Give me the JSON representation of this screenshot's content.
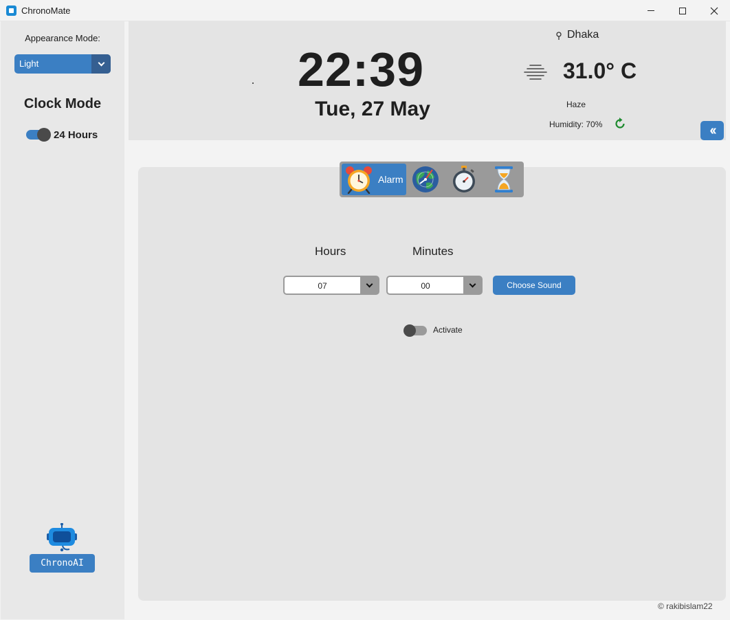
{
  "window": {
    "title": "ChronoMate",
    "controls": [
      "minimize-icon",
      "maximize-icon",
      "close-icon"
    ]
  },
  "sidebar": {
    "appearance_label": "Appearance Mode:",
    "appearance_value": "Light",
    "clock_mode_title": "Clock Mode",
    "hour_format_label": "24 Hours",
    "hour_format_on": true,
    "ai_button_label": "ChronoAI",
    "ai_icon": "robot-icon"
  },
  "header": {
    "time": "22:39",
    "date": "Tue, 27 May",
    "city": "Dhaka",
    "city_icon": "location-pin-icon",
    "temperature": "31.0° C",
    "weather_icon": "haze-icon",
    "condition": "Haze",
    "humidity": "Humidity: 70%",
    "refresh_icon": "refresh-icon",
    "collapse_label": "‹‹"
  },
  "tabs": {
    "alarm_label": "Alarm",
    "items": [
      {
        "name": "alarm",
        "icon": "alarm-clock-icon",
        "active": true
      },
      {
        "name": "world-clock",
        "icon": "world-clock-icon",
        "active": false
      },
      {
        "name": "stopwatch",
        "icon": "stopwatch-icon",
        "active": false
      },
      {
        "name": "timer",
        "icon": "hourglass-icon",
        "active": false
      }
    ]
  },
  "alarm": {
    "hours_label": "Hours",
    "minutes_label": "Minutes",
    "hours_value": "07",
    "minutes_value": "00",
    "choose_sound_label": "Choose Sound",
    "activate_label": "Activate",
    "activate_on": false
  },
  "footer": {
    "copyright": "© rakibislam22"
  },
  "colors": {
    "accent": "#3b7fc3",
    "accent_dark": "#355f91",
    "panel": "#e4e4e4",
    "sidebar": "#e8e8e8",
    "neutral": "#9a9a9a"
  }
}
